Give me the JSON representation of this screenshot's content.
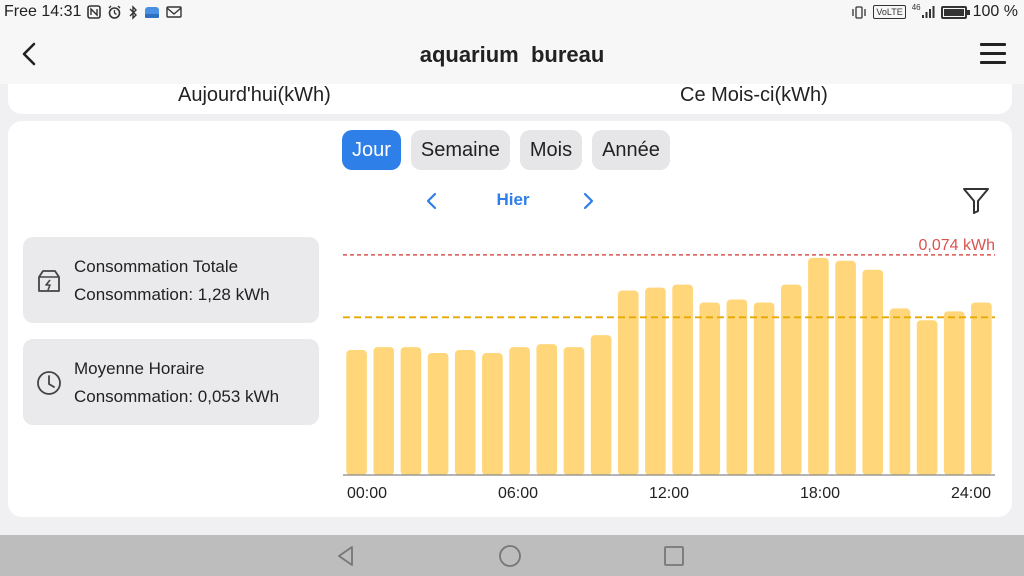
{
  "status_bar": {
    "carrier_time": "Free 14:31",
    "left_icons": [
      "nfc-icon",
      "alarm-icon",
      "bluetooth-icon",
      "notification-icon",
      "gmail-icon"
    ],
    "network_type": "46",
    "volte": "VoLTE",
    "battery_text": "100 %",
    "battery_level": 1.0
  },
  "header": {
    "title": "aquarium  bureau",
    "back_icon": "back-arrow-icon",
    "menu_icon": "hamburger-menu-icon"
  },
  "summary": {
    "today_label": "Aujourd'hui(kWh)",
    "month_label": "Ce Mois-ci(kWh)"
  },
  "tabs": [
    {
      "label": "Jour",
      "active": true
    },
    {
      "label": "Semaine",
      "active": false
    },
    {
      "label": "Mois",
      "active": false
    },
    {
      "label": "Année",
      "active": false
    }
  ],
  "date_nav": {
    "label": "Hier",
    "prev_icon": "chevron-left-icon",
    "next_icon": "chevron-right-icon",
    "filter_icon": "filter-icon"
  },
  "stats": [
    {
      "icon": "energy-box-icon",
      "title": "Consommation Totale",
      "value": "Consommation: 1,28 kWh"
    },
    {
      "icon": "clock-icon",
      "title": "Moyenne Horaire",
      "value": "Consommation: 0,053 kWh"
    }
  ],
  "chart_data": {
    "type": "bar",
    "categories": [
      "00",
      "01",
      "02",
      "03",
      "04",
      "05",
      "06",
      "07",
      "08",
      "09",
      "10",
      "11",
      "12",
      "13",
      "14",
      "15",
      "16",
      "17",
      "18",
      "19",
      "20",
      "21",
      "22",
      "23"
    ],
    "values": [
      0.042,
      0.043,
      0.043,
      0.041,
      0.042,
      0.041,
      0.043,
      0.044,
      0.043,
      0.047,
      0.062,
      0.063,
      0.064,
      0.058,
      0.059,
      0.058,
      0.064,
      0.073,
      0.072,
      0.069,
      0.056,
      0.052,
      0.055,
      0.058
    ],
    "x_ticks": [
      "00:00",
      "06:00",
      "12:00",
      "18:00",
      "24:00"
    ],
    "max_line": {
      "value": 0.074,
      "label": "0,074 kWh",
      "color": "#d9534f"
    },
    "avg_line": {
      "value": 0.053,
      "color": "#e8a800"
    },
    "bar_color": "#ffd77a",
    "ylim": [
      0,
      0.08
    ]
  },
  "colors": {
    "accent": "#2f7fe8",
    "bar": "#ffd77a"
  },
  "nav_bar": {
    "back_icon": "triangle-back-icon",
    "home_icon": "circle-home-icon",
    "recents_icon": "square-recents-icon"
  }
}
